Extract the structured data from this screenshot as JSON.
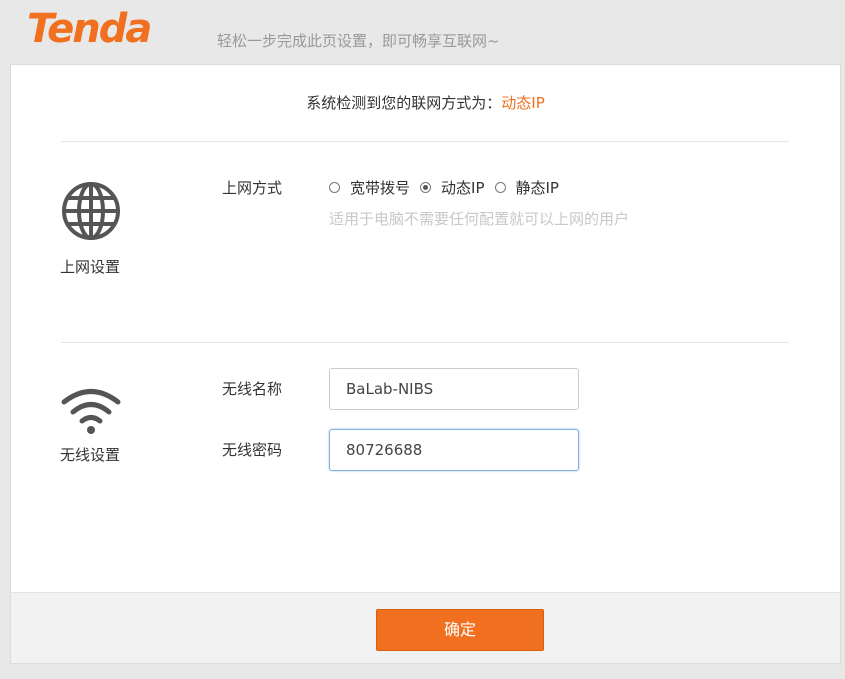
{
  "header": {
    "logo_text": "Tenda",
    "tagline": "轻松一步完成此页设置，即可畅享互联网~"
  },
  "notice": {
    "prefix": "系统检测到您的联网方式为：",
    "value": "动态IP"
  },
  "internet_section": {
    "icon": "globe-icon",
    "label": "上网设置",
    "row_label": "上网方式",
    "options": [
      {
        "label": "宽带拨号",
        "checked": false
      },
      {
        "label": "动态IP",
        "checked": true
      },
      {
        "label": "静态IP",
        "checked": false
      }
    ],
    "hint": "适用于电脑不需要任何配置就可以上网的用户"
  },
  "wireless_section": {
    "icon": "wifi-icon",
    "label": "无线设置",
    "ssid_label": "无线名称",
    "ssid_value": "BaLab-NIBS",
    "password_label": "无线密码",
    "password_value": "80726688"
  },
  "footer": {
    "confirm_label": "确定"
  },
  "colors": {
    "accent": "#f07020",
    "hint": "#c8c8c8"
  }
}
